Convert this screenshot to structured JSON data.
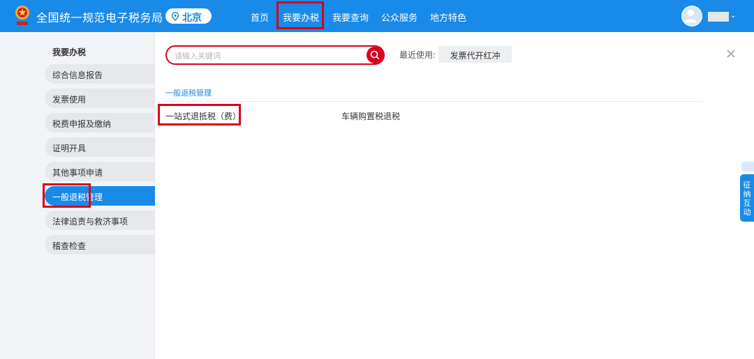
{
  "header": {
    "site_title": "全国统一规范电子税务局",
    "region": "北京",
    "nav": [
      "首页",
      "我要办税",
      "我要查询",
      "公众服务",
      "地方特色"
    ],
    "active_nav": "我要办税"
  },
  "sidebar": {
    "title": "我要办税",
    "items": [
      {
        "label": "综合信息报告"
      },
      {
        "label": "发票使用"
      },
      {
        "label": "税费申报及缴纳"
      },
      {
        "label": "证明开具"
      },
      {
        "label": "其他事项申请"
      },
      {
        "label": "一般退税管理"
      },
      {
        "label": "法律追责与救济事项"
      },
      {
        "label": "稽查检查"
      }
    ],
    "active_item": "一般退税管理"
  },
  "search": {
    "placeholder": "请输入关键词"
  },
  "recent": {
    "label": "最近使用:",
    "items": [
      "发票代开红冲"
    ]
  },
  "section": {
    "title": "一般退税管理",
    "services": [
      "一站式退抵税（费）",
      "车辆购置税退税"
    ]
  },
  "float_widget": {
    "label": "征纳互动"
  },
  "colors": {
    "brand_blue": "#1a8ae8",
    "highlight_red": "#d9001b",
    "sidebar_bg": "#f3f4f7"
  },
  "icons": [
    "national-emblem-icon",
    "location-pin-icon",
    "user-avatar-icon",
    "chevron-down-icon",
    "search-icon",
    "close-icon"
  ]
}
